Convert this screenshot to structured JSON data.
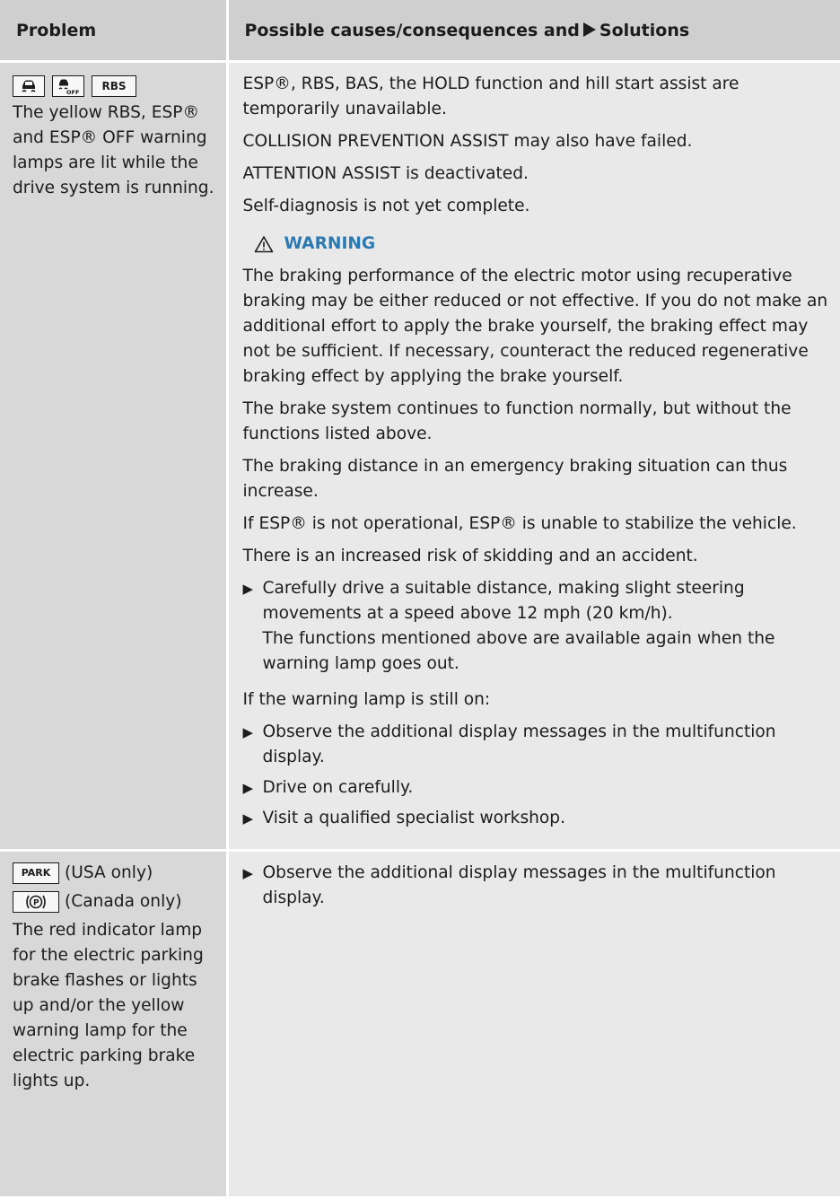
{
  "header": {
    "col1": "Problem",
    "col2_pre": "Possible causes/consequences and",
    "col2_post": "Solutions"
  },
  "row1": {
    "icons": [
      "esp-skid-icon",
      "esp-off-icon",
      "RBS"
    ],
    "problem": "The yellow RBS, ESP® and ESP® OFF warning lamps are lit while the drive system is running.",
    "lines": [
      "ESP®, RBS, BAS, the HOLD function and hill start assist are temporarily unavailable.",
      "COLLISION PREVENTION ASSIST may also have failed.",
      "ATTENTION ASSIST is deactivated.",
      "Self-diagnosis is not yet complete."
    ],
    "warning_title": "WARNING",
    "warning_text": "The braking performance of the electric motor using recuperative braking may be either reduced or not effective. If you do not make an additional effort to apply the brake yourself, the braking effect may not be sufficient. If necessary, counteract the reduced regenerative braking effect by applying the brake yourself.",
    "lines2": [
      "The brake system continues to function normally, but without the functions listed above.",
      "The braking distance in an emergency braking situation can thus increase.",
      "If ESP® is not operational, ESP® is unable to stabilize the vehicle.",
      "There is an increased risk of skidding and an accident."
    ],
    "step1": "Carefully drive a suitable distance, making slight steering movements at a speed above 12 mph (20 km/h).",
    "step1_note": "The functions mentioned above are available again when the warning lamp goes out.",
    "still_on": "If the warning lamp is still on:",
    "steps2": [
      "Observe the additional display messages in the multifunction display.",
      "Drive on carefully.",
      "Visit a qualified specialist workshop."
    ]
  },
  "row2": {
    "park_label": "PARK",
    "park_note": "(USA only)",
    "p_note": "(Canada only)",
    "problem": "The red indicator lamp for the electric parking brake flashes or lights up and/or the yellow warning lamp for the electric parking brake lights up.",
    "step": "Observe the additional display messages in the multifunction display."
  }
}
